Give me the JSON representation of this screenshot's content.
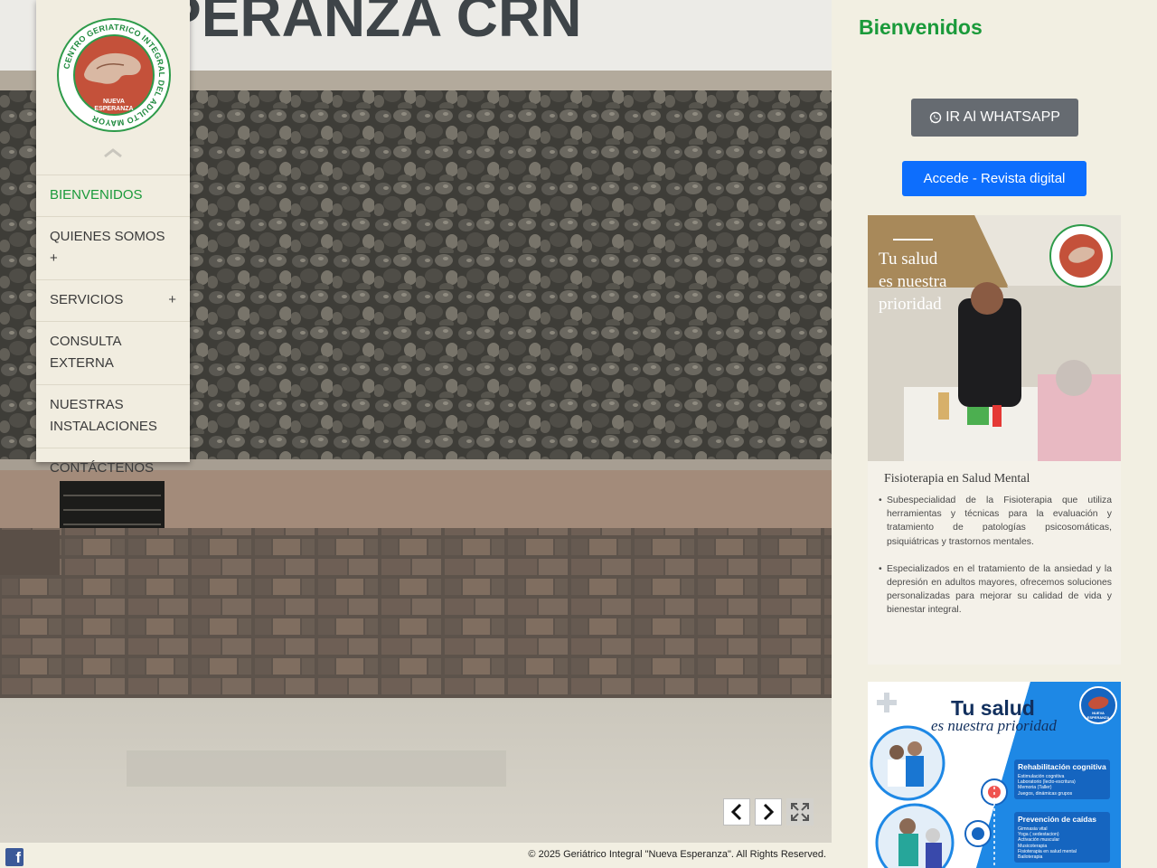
{
  "brand": {
    "logo_ring_text": "CENTRO GERIATRICO INTEGRAL DEL ADULTO MAYOR",
    "logo_line1": "NUEVA",
    "logo_line2": "ESPERANZA"
  },
  "sidebar": {
    "items": [
      {
        "label": "BIENVENIDOS",
        "active": true,
        "has_submenu": false
      },
      {
        "label": "QUIENES SOMOS +",
        "active": false,
        "has_submenu": false
      },
      {
        "label": "SERVICIOS",
        "active": false,
        "has_submenu": true
      },
      {
        "label": "CONSULTA EXTERNA",
        "active": false,
        "has_submenu": false
      },
      {
        "label": "NUESTRAS INSTALACIONES",
        "active": false,
        "has_submenu": false
      },
      {
        "label": "CONTÁCTENOS",
        "active": false,
        "has_submenu": false
      }
    ],
    "submenu_symbol": "+"
  },
  "hero": {
    "sign_text": "PERANZA CRN"
  },
  "slider": {
    "prev_icon": "chevron-left-icon",
    "next_icon": "chevron-right-icon",
    "fullscreen_icon": "fullscreen-icon"
  },
  "footer": {
    "facebook_glyph": "f",
    "copyright": "© 2025 Geriátrico Integral \"Nueva Esperanza\". All Rights Reserved."
  },
  "main": {
    "title": "Bienvenidos",
    "whatsapp_button": "IR Al WHATSAPP",
    "revista_button": "Accede - Revista digital"
  },
  "poster1": {
    "headline_1": "Tu salud",
    "headline_2": "es nuestra",
    "headline_3": "prioridad",
    "section_title": "Fisioterapia en Salud Mental",
    "bullets": [
      "Subespecialidad de la Fisioterapia que utiliza herramientas y técnicas para la evaluación y tratamiento de patologías psicosomáticas, psiquiátricas y trastornos mentales.",
      "Especializados en el tratamiento de la ansiedad y la depresión en adultos mayores, ofrecemos soluciones personalizadas para mejorar su calidad de vida y bienestar integral."
    ]
  },
  "poster2": {
    "headline_1": "Tu salud",
    "headline_2": "es nuestra prioridad",
    "logo_line1": "NUEVA",
    "logo_line2": "ESPERANZA",
    "cards": [
      {
        "title": "Rehabilitación cognitiva",
        "items": [
          "Estimulación cognitiva",
          "Laboratorio (lecto-escritura)",
          "Memoria (Taller)",
          "Juegos, dinámicas grupos"
        ]
      },
      {
        "title": "Prevención de caídas",
        "items": [
          "Gimnasia vital",
          "Yoga ( sedestacion)",
          "Activación muscular",
          "Musicoterapia",
          "Fisioterapia en salud mental",
          "Bailoterapia"
        ]
      }
    ]
  },
  "colors": {
    "accent_green": "#1a9a3a",
    "whatsapp_button_bg": "#666b71",
    "revista_button_bg": "#0d6efd",
    "page_bg": "#f2efe2"
  }
}
